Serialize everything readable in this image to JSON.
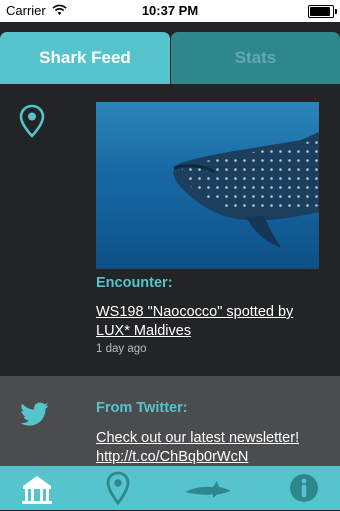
{
  "status_bar": {
    "carrier": "Carrier",
    "time": "10:37 PM"
  },
  "tabs": [
    {
      "label": "Shark Feed",
      "active": true
    },
    {
      "label": "Stats",
      "active": false
    }
  ],
  "feed": [
    {
      "icon": "map-pin-icon",
      "heading": "Encounter:",
      "text": "WS198 \"Naococco\" spotted by LUX* Maldives",
      "time": "1 day ago"
    },
    {
      "icon": "twitter-bird-icon",
      "heading": "From Twitter:",
      "text": "Check out our latest newsletter! http://t.co/ChBqb0rWcN"
    }
  ],
  "tab_bar": [
    {
      "icon": "home-icon",
      "active": true
    },
    {
      "icon": "map-pin-icon"
    },
    {
      "icon": "shark-icon"
    },
    {
      "icon": "info-icon"
    }
  ],
  "colors": {
    "accent": "#55c4cc",
    "tab_inactive": "#2d878d",
    "background": "#232425",
    "card_alt": "#4b4c4d"
  }
}
